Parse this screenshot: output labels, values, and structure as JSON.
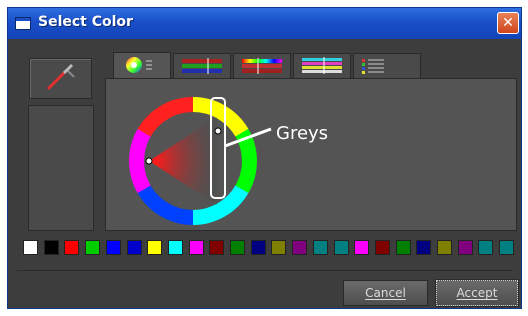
{
  "window": {
    "title": "Select Color",
    "close_symbol": "✕"
  },
  "tabs": [
    {
      "icon": "color-wheel-icon",
      "active": true
    },
    {
      "icon": "rgb-sliders-icon",
      "active": false
    },
    {
      "icon": "hsv-sliders-icon",
      "active": false
    },
    {
      "icon": "cmyk-sliders-icon",
      "active": false
    },
    {
      "icon": "palette-list-icon",
      "active": false
    }
  ],
  "annotation": {
    "label": "Greys"
  },
  "swatches": [
    "#ffffff",
    "#000000",
    "#ff0000",
    "#00cc00",
    "#0000ff",
    "#0000cc",
    "#ffff00",
    "#00ffff",
    "#ff00ff",
    "#800000",
    "#008000",
    "#000080",
    "#808000",
    "#800080",
    "#008080",
    "#008080",
    "#ff00ff",
    "#800000",
    "#008000",
    "#000080",
    "#808000",
    "#800080",
    "#008080",
    "#008080"
  ],
  "buttons": {
    "cancel": "Cancel",
    "accept": "Accept"
  },
  "colors": {
    "title_bar": "#1a4fc9",
    "dialog_bg": "#3d3d3d",
    "panel_bg": "#545454"
  }
}
